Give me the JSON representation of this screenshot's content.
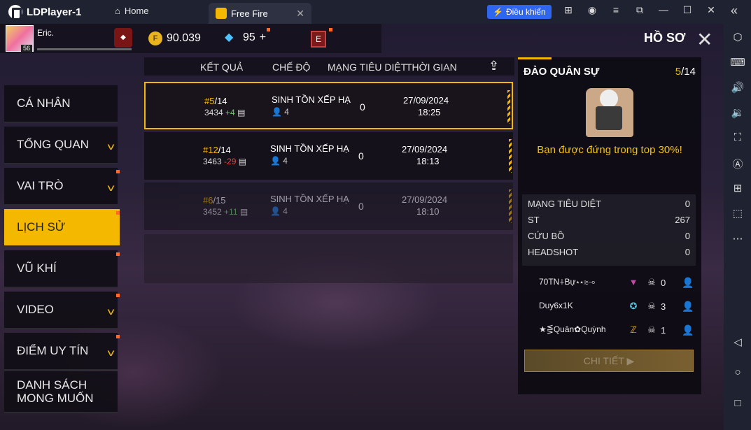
{
  "titlebar": {
    "app_name": "LDPlayer-1",
    "home_label": "Home",
    "tab_label": "Free Fire",
    "control_label": "Điều khiển"
  },
  "player": {
    "name": "Eric.",
    "level": "56",
    "gold": "90.039",
    "diamonds": "95",
    "diamond_plus": "+",
    "e_badge": "E"
  },
  "header": {
    "title": "HỒ SƠ"
  },
  "sidebar": {
    "items": [
      {
        "label": "CÁ NHÂN"
      },
      {
        "label": "TỔNG QUAN"
      },
      {
        "label": "VAI TRÒ"
      },
      {
        "label": "LỊCH SỬ"
      },
      {
        "label": "VŨ KHÍ"
      },
      {
        "label": "VIDEO"
      },
      {
        "label": "ĐIỂM UY TÍN"
      },
      {
        "label_line1": "DANH SÁCH",
        "label_line2": "MONG MUỐN"
      }
    ]
  },
  "table": {
    "headers": [
      "KẾT QUẢ",
      "CHẾ ĐỘ",
      "MẠNG TIÊU DIỆT",
      "THỜI GIAN"
    ],
    "rows": [
      {
        "rank": "#5",
        "total": "/14",
        "points": "3434",
        "delta": "+4",
        "mode": "SINH TỒN XẾP HẠ",
        "players": "4",
        "kills": "0",
        "date": "27/09/2024",
        "time": "18:25"
      },
      {
        "rank": "#12",
        "total": "/14",
        "points": "3463",
        "delta": "-29",
        "mode": "SINH TỒN XẾP HẠ",
        "players": "4",
        "kills": "0",
        "date": "27/09/2024",
        "time": "18:13"
      },
      {
        "rank": "#6",
        "total": "/15",
        "points": "3452",
        "delta": "+11",
        "mode": "SINH TỒN XẾP HẠ",
        "players": "4",
        "kills": "0",
        "date": "27/09/2024",
        "time": "18:10"
      }
    ]
  },
  "detail_panel": {
    "title": "ĐẢO QUÂN SỰ",
    "rank": "5",
    "total": "/14",
    "message": "Bạn được đứng trong top 30%!",
    "stats": [
      {
        "label": "MẠNG TIÊU DIỆT",
        "value": "0"
      },
      {
        "label": "ST",
        "value": "267"
      },
      {
        "label": "CỨU BỒ",
        "value": "0"
      },
      {
        "label": "HEADSHOT",
        "value": "0"
      }
    ],
    "teammates": [
      {
        "name": "70TN⍭Bự⋆⋆≋⊸",
        "kills": "0",
        "rank_color": "#c44aa8"
      },
      {
        "name": "Duy6x1K",
        "kills": "3",
        "rank_color": "#4fc6d8"
      },
      {
        "name": "★⋚Quân✿Quỳnh",
        "kills": "1",
        "rank_color": "#e8b31c"
      }
    ],
    "detail_button": "CHI TIẾT ▶"
  }
}
